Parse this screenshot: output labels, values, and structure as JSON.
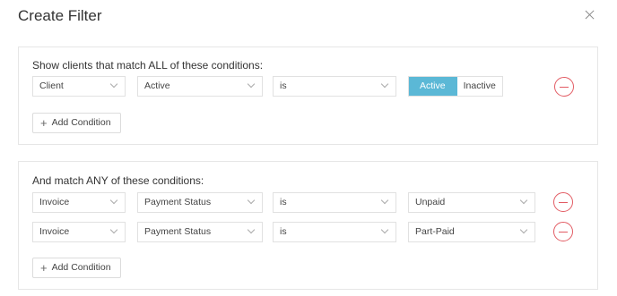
{
  "dialog": {
    "title": "Create Filter"
  },
  "all_section": {
    "heading": "Show clients that match ALL of these conditions:",
    "condition": {
      "field": "Client",
      "property": "Active",
      "operator": "is",
      "toggle_active": "Active",
      "toggle_inactive": "Inactive"
    },
    "add_label": "Add Condition"
  },
  "any_section": {
    "heading": "And match ANY of these conditions:",
    "conditions": [
      {
        "field": "Invoice",
        "property": "Payment Status",
        "operator": "is",
        "value": "Unpaid"
      },
      {
        "field": "Invoice",
        "property": "Payment Status",
        "operator": "is",
        "value": "Part-Paid"
      }
    ],
    "add_label": "Add Condition"
  },
  "icons": {
    "close": "close-icon",
    "remove": "minus-circle-icon",
    "add": "plus-icon",
    "dropdown": "chevron-down-icon"
  },
  "colors": {
    "accent": "#5bb8d6",
    "danger": "#e25b63",
    "border": "#e6e6e6"
  }
}
